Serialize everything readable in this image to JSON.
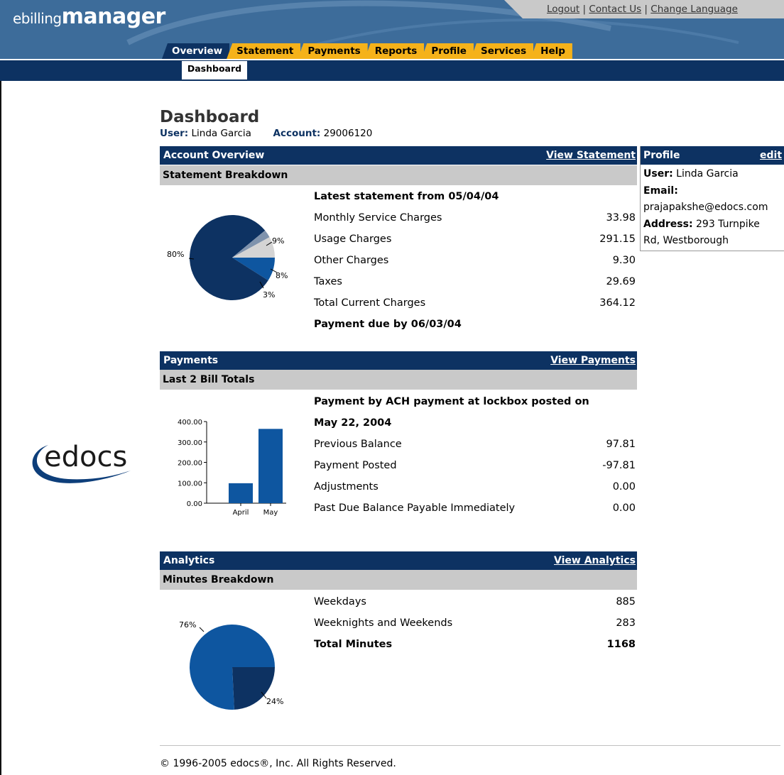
{
  "app": {
    "logo_light": "ebilling",
    "logo_bold": "manager"
  },
  "top_links": {
    "logout": "Logout",
    "contact": "Contact Us",
    "change_language": "Change Language",
    "separator": "|"
  },
  "tabs": [
    {
      "label": "Overview",
      "active": true
    },
    {
      "label": "Statement"
    },
    {
      "label": "Payments"
    },
    {
      "label": "Reports"
    },
    {
      "label": "Profile"
    },
    {
      "label": "Services"
    },
    {
      "label": "Help"
    }
  ],
  "subtab": "Dashboard",
  "side_logo": "edocs",
  "page": {
    "title": "Dashboard",
    "user_label": "User:",
    "user_value": "Linda Garcia",
    "account_label": "Account:",
    "account_value": "29006120"
  },
  "account_overview": {
    "header": "Account Overview",
    "link": "View Statement",
    "subheader": "Statement Breakdown",
    "latest": "Latest statement from 05/04/04",
    "rows": [
      {
        "label": "Monthly Service Charges",
        "value": "33.98"
      },
      {
        "label": "Usage Charges",
        "value": "291.15"
      },
      {
        "label": "Other Charges",
        "value": "9.30"
      },
      {
        "label": "Taxes",
        "value": "29.69"
      },
      {
        "label": "Total Current Charges",
        "value": "364.12"
      }
    ],
    "due": "Payment due by 06/03/04",
    "pie_labels": [
      "80%",
      "9%",
      "8%",
      "3%"
    ]
  },
  "payments": {
    "header": "Payments",
    "link": "View Payments",
    "subheader": "Last 2 Bill Totals",
    "posted_line1": "Payment by ACH payment at lockbox posted on",
    "posted_line2": "May 22, 2004",
    "rows": [
      {
        "label": "Previous Balance",
        "value": "97.81"
      },
      {
        "label": "Payment Posted",
        "value": "-97.81"
      },
      {
        "label": "Adjustments",
        "value": "0.00"
      },
      {
        "label": "Past Due Balance Payable Immediately",
        "value": "0.00"
      }
    ]
  },
  "analytics": {
    "header": "Analytics",
    "link": "View Analytics",
    "subheader": "Minutes Breakdown",
    "rows": [
      {
        "label": "Weekdays",
        "value": "885"
      },
      {
        "label": "Weeknights and Weekends",
        "value": "283"
      }
    ],
    "total_label": "Total Minutes",
    "total_value": "1168",
    "pie_labels": [
      "76%",
      "24%"
    ]
  },
  "profile": {
    "header": "Profile",
    "edit": "edit",
    "user_label": "User:",
    "user_value": "Linda Garcia",
    "email_label": "Email:",
    "email_value": "prajapakshe@edocs.com",
    "address_label": "Address:",
    "address_value_1": "293 Turnpike",
    "address_value_2": "Rd, Westborough"
  },
  "footer": "© 1996-2005 edocs®, Inc. All Rights Reserved.",
  "colors": {
    "navy": "#0d3262",
    "header_blue": "#3d6c9a",
    "tab_orange": "#f5b21a",
    "chart_blue": "#0e56a0",
    "gray_bar": "#c9c9c9"
  },
  "chart_data": [
    {
      "type": "pie",
      "title": "",
      "categories": [
        "Monthly Service Charges",
        "Usage Charges",
        "Other Charges",
        "Taxes"
      ],
      "values": [
        9,
        80,
        3,
        8
      ],
      "labels": [
        "9%",
        "80%",
        "3%",
        "8%"
      ]
    },
    {
      "type": "bar",
      "title": "",
      "categories": [
        "April",
        "May"
      ],
      "values": [
        97.81,
        364.12
      ],
      "ylim": [
        0,
        400
      ],
      "yticks": [
        "0.00",
        "100.00",
        "200.00",
        "300.00",
        "400.00"
      ],
      "ytick_values": [
        0,
        100,
        200,
        300,
        400
      ]
    },
    {
      "type": "pie",
      "title": "",
      "categories": [
        "Weekdays",
        "Weeknights and Weekends"
      ],
      "values": [
        885,
        283
      ],
      "labels": [
        "76%",
        "24%"
      ]
    }
  ]
}
